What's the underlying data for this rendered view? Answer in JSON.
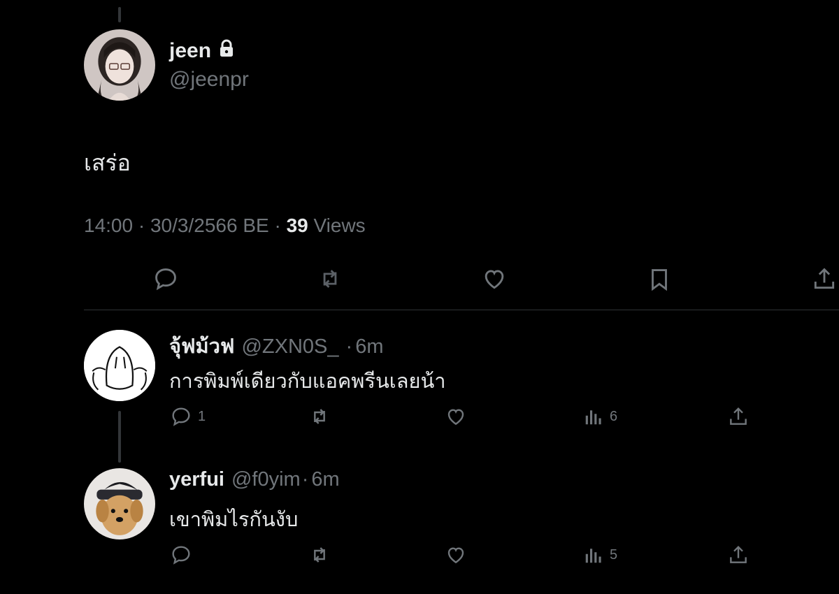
{
  "tweet": {
    "author_name": "jeen",
    "author_handle": "@jeenpr",
    "protected_icon": "lock-icon",
    "text": "เสร่อ",
    "time": "14:00",
    "date": "30/3/2566 BE",
    "views_count": "39",
    "views_label": "Views",
    "separator": "·"
  },
  "replies": [
    {
      "name": "จุ้ฟม้วฟ",
      "handle": "@ZXN0S_",
      "age": "6m",
      "text": "การพิมพ์เดียวกับแอคพรีนเลยน้า",
      "reply_count": "1",
      "views": "6"
    },
    {
      "name": "yerfui",
      "handle": "@f0yim",
      "age": "6m",
      "text": "เขาพิมไรกันงับ",
      "reply_count": "",
      "views": "5"
    }
  ],
  "icons": {
    "reply": "reply-icon",
    "retweet": "retweet-icon",
    "like": "heart-icon",
    "bookmark": "bookmark-icon",
    "share": "share-icon",
    "views": "views-chart-icon"
  },
  "colors": {
    "background": "#000000",
    "text": "#e7e9ea",
    "muted": "#71767b",
    "divider": "#2f3336"
  }
}
